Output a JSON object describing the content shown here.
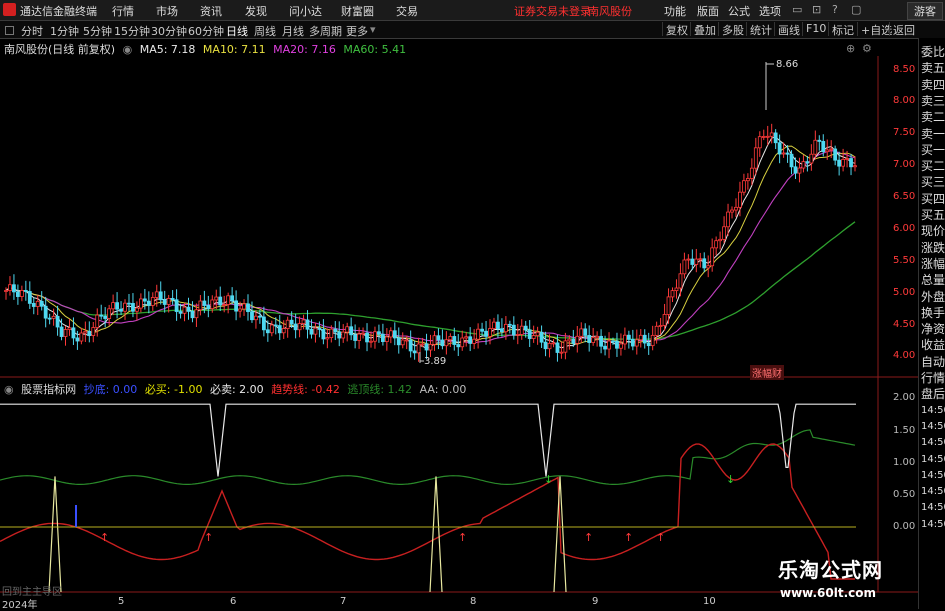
{
  "app": {
    "name": "通达信金融终端",
    "menu": [
      "行情",
      "市场",
      "资讯",
      "发现",
      "问小达",
      "财富圈",
      "交易"
    ],
    "login_status": "证券交易未登录",
    "stock_short": "南风股份",
    "right_menu": [
      "功能",
      "版面",
      "公式",
      "选项"
    ],
    "guest": "游客"
  },
  "periods": {
    "items": [
      "分时",
      "1分钟",
      "5分钟",
      "15分钟",
      "30分钟",
      "60分钟",
      "日线",
      "周线",
      "月线",
      "多周期",
      "更多"
    ],
    "active": "日线"
  },
  "toolbar_right": [
    "复权",
    "叠加",
    "多股",
    "统计",
    "画线",
    "F10",
    "标记",
    "+自选",
    "返回"
  ],
  "main_chart": {
    "title": "南风股份(日线 前复权)",
    "ma": [
      {
        "label": "MA5: 7.18",
        "color": "#e8e8e8"
      },
      {
        "label": "MA10: 7.11",
        "color": "#e8e040"
      },
      {
        "label": "MA20: 7.16",
        "color": "#e040e0"
      },
      {
        "label": "MA60: 5.41",
        "color": "#40c040"
      }
    ],
    "high_label": "8.66",
    "low_label": "3.89",
    "tag": "涨幅财",
    "y_ticks": [
      "8.50",
      "8.00",
      "7.50",
      "7.00",
      "6.50",
      "6.00",
      "5.50",
      "5.00",
      "4.50",
      "4.00"
    ]
  },
  "indicator": {
    "name": "股票指标网",
    "values": [
      {
        "label": "抄底: 0.00",
        "color": "#3a4fff"
      },
      {
        "label": "必买: -1.00",
        "color": "#e0e000"
      },
      {
        "label": "必卖: 2.00",
        "color": "#e8e8e8"
      },
      {
        "label": "趋势线: -0.42",
        "color": "#ff3030"
      },
      {
        "label": "逃顶线: 1.42",
        "color": "#2a8a2a"
      },
      {
        "label": "AA: 0.00",
        "color": "#bbbbbb"
      }
    ],
    "y_ticks": [
      "2.00",
      "1.50",
      "1.00",
      "0.50",
      "0.00"
    ]
  },
  "side_panel": [
    "委比",
    "卖五",
    "卖四",
    "卖三",
    "卖二",
    "卖一",
    "买一",
    "买二",
    "买三",
    "买四",
    "买五",
    "现价",
    "涨跌",
    "涨幅",
    "总量",
    "外盘",
    "换手",
    "净资",
    "收益",
    "自动",
    "行情",
    "盘后",
    "14:50",
    "14:50",
    "14:50",
    "14:50",
    "14:50",
    "14:50",
    "14:50",
    "14:50"
  ],
  "x_axis": [
    "2024年",
    "5",
    "6",
    "7",
    "8",
    "9",
    "10"
  ],
  "status_text": "回到主主导区",
  "watermark": {
    "title": "乐淘公式网",
    "url": "www.60lt.com"
  },
  "chart_data": [
    {
      "type": "candlestick",
      "title": "南风股份(日线 前复权)",
      "x_categories": [
        "2024年",
        "5",
        "6",
        "7",
        "8",
        "9",
        "10"
      ],
      "ylim": [
        3.8,
        8.8
      ],
      "annotations": {
        "max": 8.66,
        "min": 3.89
      },
      "approx_close_path": [
        5.05,
        4.95,
        4.8,
        4.35,
        4.3,
        4.6,
        4.75,
        4.85,
        4.9,
        4.85,
        4.7,
        4.8,
        4.95,
        4.7,
        4.45,
        4.5,
        4.45,
        4.4,
        4.35,
        4.3,
        4.35,
        4.25,
        4.15,
        4.2,
        4.2,
        4.3,
        4.35,
        4.5,
        4.4,
        4.2,
        4.15,
        4.3,
        4.25,
        4.2,
        4.2,
        4.3,
        4.9,
        5.6,
        5.5,
        6.1,
        6.8,
        7.6,
        7.3,
        7.0,
        7.4,
        7.2,
        7.1
      ],
      "series": [
        {
          "name": "MA5",
          "last": 7.18
        },
        {
          "name": "MA10",
          "last": 7.11
        },
        {
          "name": "MA20",
          "last": 7.16
        },
        {
          "name": "MA60",
          "last": 5.41
        }
      ]
    },
    {
      "type": "line",
      "title": "股票指标网",
      "ylim": [
        -0.6,
        2.1
      ],
      "series": [
        {
          "name": "必卖",
          "last": 2.0
        },
        {
          "name": "趋势线",
          "last": -0.42
        },
        {
          "name": "逃顶线",
          "last": 1.42
        },
        {
          "name": "必买",
          "last": -1.0
        },
        {
          "name": "抄底",
          "last": 0.0
        },
        {
          "name": "AA",
          "last": 0.0
        }
      ]
    }
  ]
}
